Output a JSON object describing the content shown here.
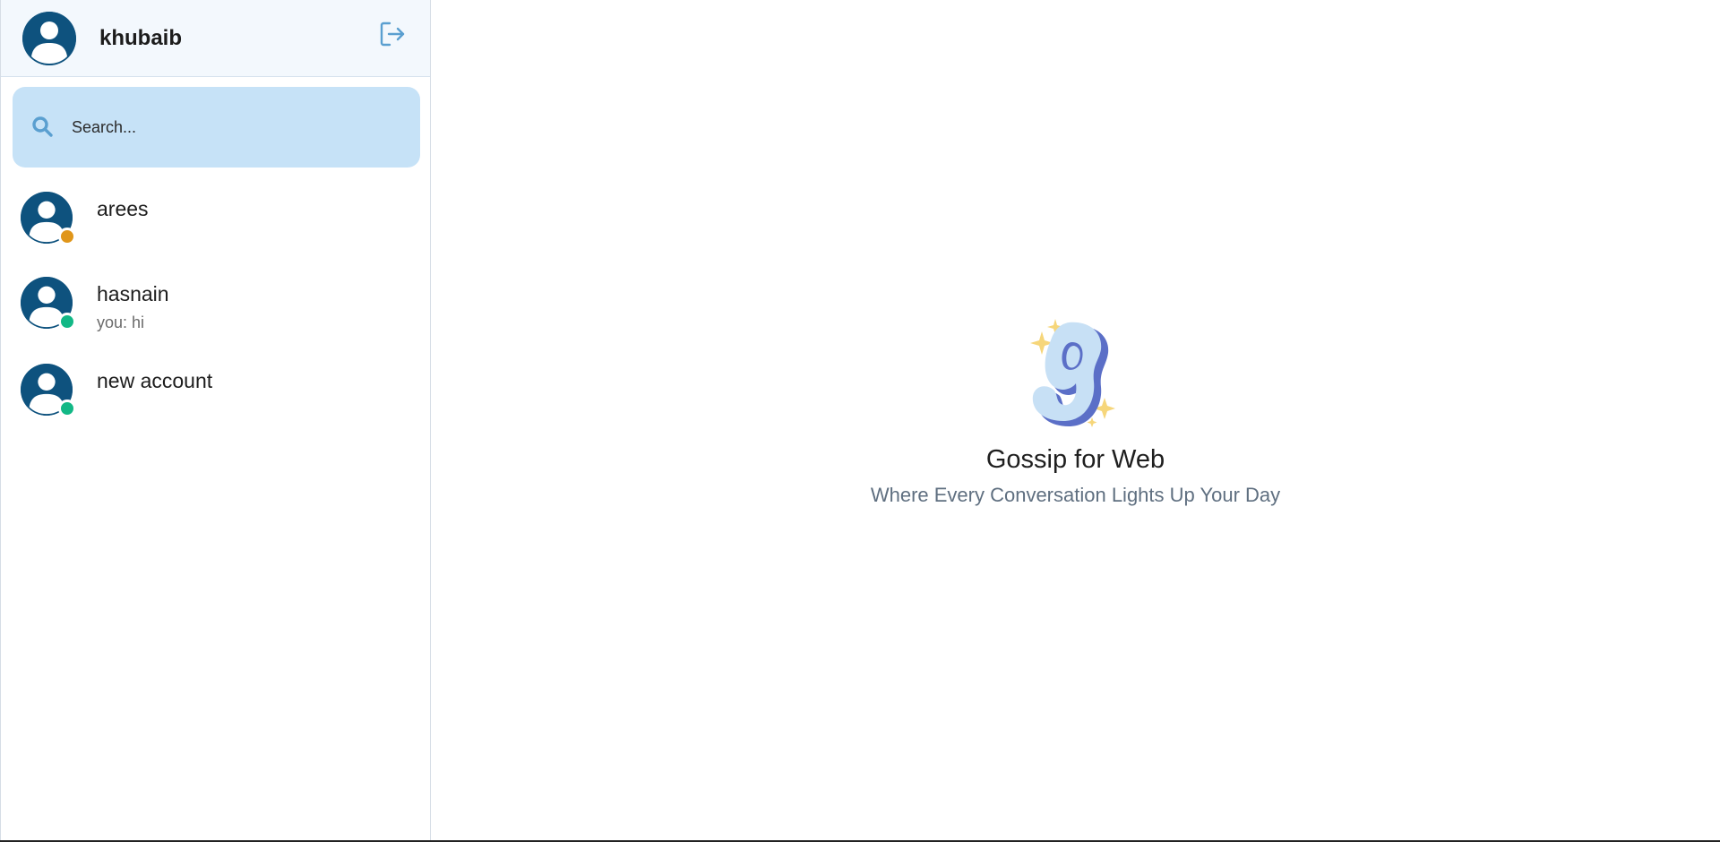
{
  "user": {
    "name": "khubaib",
    "avatar_icon": "user-avatar-icon"
  },
  "header": {
    "logout_icon": "logout-icon"
  },
  "search": {
    "placeholder": "Search...",
    "icon": "search-icon"
  },
  "contacts": [
    {
      "name": "arees",
      "preview": "",
      "status_color": "#e0961a"
    },
    {
      "name": "hasnain",
      "preview": "you: hi",
      "status_color": "#12b886"
    },
    {
      "name": "new account",
      "preview": "",
      "status_color": "#12b886"
    }
  ],
  "welcome": {
    "title": "Gossip for Web",
    "subtitle": "Where Every Conversation Lights Up Your Day",
    "logo_icon": "gossip-logo-icon"
  },
  "colors": {
    "accent": "#0e527e",
    "search_bg": "#c6e2f7",
    "header_bg": "#f3f8fd",
    "away": "#e0961a",
    "online": "#12b886"
  }
}
